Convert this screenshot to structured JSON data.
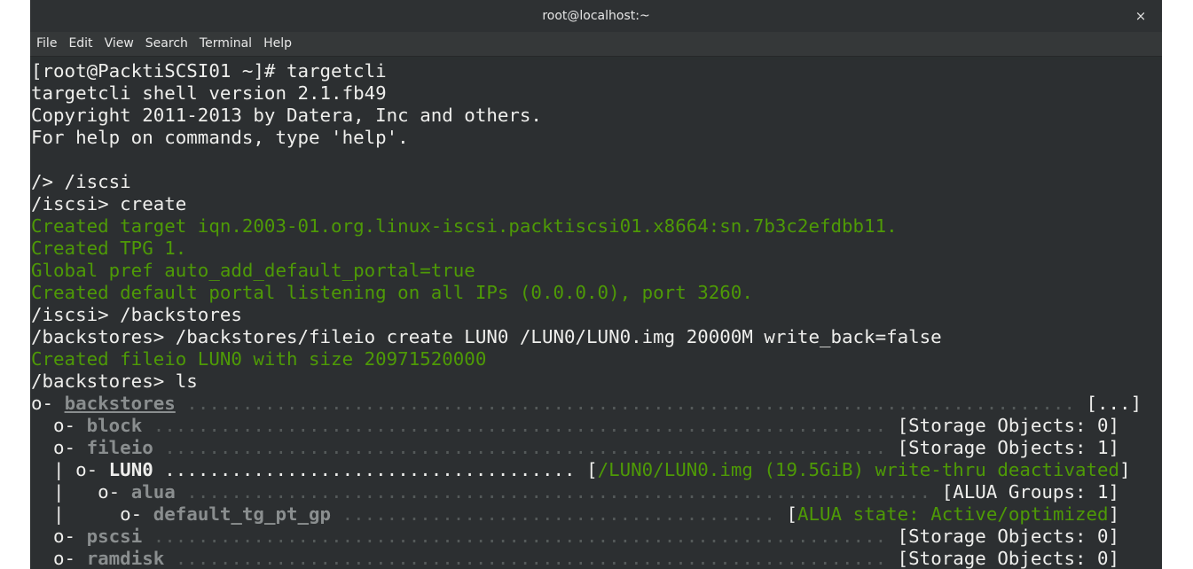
{
  "window": {
    "title": "root@localhost:~",
    "close_icon": "×"
  },
  "menu": [
    "File",
    "Edit",
    "View",
    "Search",
    "Terminal",
    "Help"
  ],
  "terminal": {
    "lines": [
      [
        {
          "t": "[root@PacktiSCSI01 ~]# targetcli"
        }
      ],
      [
        {
          "t": "targetcli shell version 2.1.fb49"
        }
      ],
      [
        {
          "t": "Copyright 2011-2013 by Datera, Inc and others."
        }
      ],
      [
        {
          "t": "For help on commands, type 'help'."
        }
      ],
      [
        {
          "t": ""
        }
      ],
      [
        {
          "t": "/> /iscsi"
        }
      ],
      [
        {
          "t": "/iscsi> create"
        }
      ],
      [
        {
          "t": "Created target iqn.2003-01.org.linux-iscsi.packtiscsi01.x8664:sn.7b3c2efdbb11.",
          "c": "green"
        }
      ],
      [
        {
          "t": "Created TPG 1.",
          "c": "green"
        }
      ],
      [
        {
          "t": "Global pref auto_add_default_portal=true",
          "c": "green"
        }
      ],
      [
        {
          "t": "Created default portal listening on all IPs (0.0.0.0), port 3260.",
          "c": "green"
        }
      ],
      [
        {
          "t": "/iscsi> /backstores"
        }
      ],
      [
        {
          "t": "/backstores> /backstores/fileio create LUN0 /LUN0/LUN0.img 20000M write_back=false"
        }
      ],
      [
        {
          "t": "Created fileio LUN0 with size 20971520000",
          "c": "green"
        }
      ],
      [
        {
          "t": "/backstores> ls"
        }
      ],
      [
        {
          "t": "o- "
        },
        {
          "t": "backstores",
          "c": "muted ul"
        },
        {
          "t": " ................................................................................ ",
          "c": "dots"
        },
        {
          "t": "[...]"
        }
      ],
      [
        {
          "t": "  o- "
        },
        {
          "t": "block",
          "c": "muted"
        },
        {
          "t": " .................................................................. ",
          "c": "dots"
        },
        {
          "t": "[Storage Objects: 0]"
        }
      ],
      [
        {
          "t": "  o- "
        },
        {
          "t": "fileio",
          "c": "muted"
        },
        {
          "t": " ................................................................. ",
          "c": "dots"
        },
        {
          "t": "[Storage Objects: 1]"
        }
      ],
      [
        {
          "t": "  | o- "
        },
        {
          "t": "LUN0",
          "c": "bold"
        },
        {
          "t": " ..................................... "
        },
        {
          "t": "["
        },
        {
          "t": "/LUN0/LUN0.img (19.5GiB) write-thru deactivated",
          "c": "green"
        },
        {
          "t": "]"
        }
      ],
      [
        {
          "t": "  |   o- "
        },
        {
          "t": "alua",
          "c": "muted"
        },
        {
          "t": " ................................................................... ",
          "c": "dots"
        },
        {
          "t": "[ALUA Groups: 1]"
        }
      ],
      [
        {
          "t": "  |     o- "
        },
        {
          "t": "default_tg_pt_gp",
          "c": "muted"
        },
        {
          "t": " ....................................... ",
          "c": "dots"
        },
        {
          "t": "["
        },
        {
          "t": "ALUA state: Active/optimized",
          "c": "green"
        },
        {
          "t": "]"
        }
      ],
      [
        {
          "t": "  o- "
        },
        {
          "t": "pscsi",
          "c": "muted"
        },
        {
          "t": " .................................................................. ",
          "c": "dots"
        },
        {
          "t": "[Storage Objects: 0]"
        }
      ],
      [
        {
          "t": "  o- "
        },
        {
          "t": "ramdisk",
          "c": "muted"
        },
        {
          "t": " ................................................................ ",
          "c": "dots"
        },
        {
          "t": "[Storage Objects: 0]"
        }
      ]
    ]
  }
}
